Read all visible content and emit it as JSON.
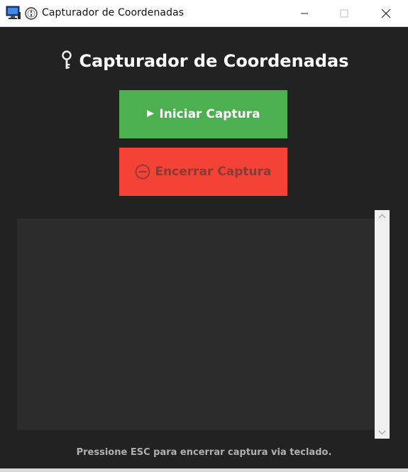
{
  "window": {
    "title": "Capturador de Coordenadas",
    "controls": {
      "minimize": "—",
      "maximize": "☐",
      "close": "✕"
    }
  },
  "main": {
    "heading": "Capturador de Coordenadas",
    "heading_icon": "key-icon",
    "start_button": {
      "label": "Iniciar Captura",
      "icon": "play-icon",
      "color": "#4caf50"
    },
    "stop_button": {
      "label": "Encerrar Captura",
      "icon": "no-entry-icon",
      "color": "#f44336",
      "enabled": false
    },
    "log_text": "",
    "footer": "Pressione ESC para encerrar captura via teclado."
  },
  "colors": {
    "background": "#222222",
    "log_background": "#2c2c2c",
    "accent_green": "#4caf50",
    "accent_red": "#f44336"
  }
}
